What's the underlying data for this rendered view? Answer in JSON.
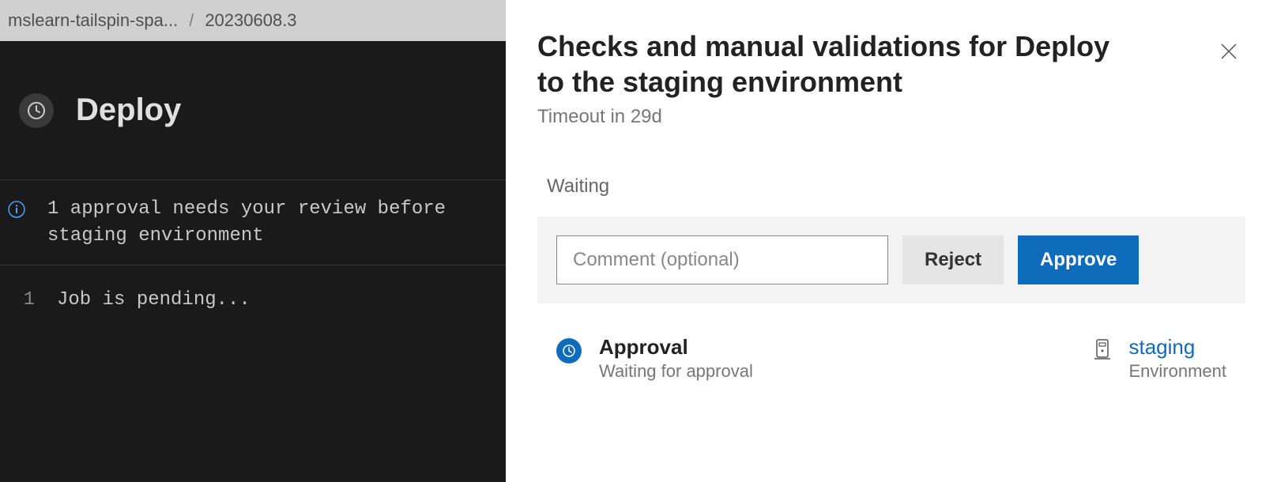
{
  "breadcrumb": {
    "pipeline": "mslearn-tailspin-spa...",
    "separator": "/",
    "run": "20230608.3"
  },
  "stage": {
    "title": "Deploy"
  },
  "banner": {
    "message": "1 approval needs your review before\nstaging environment"
  },
  "log": {
    "line_number": "1",
    "text": "Job is pending..."
  },
  "panel": {
    "title": "Checks and manual validations for Deploy to the staging environment",
    "subtitle": "Timeout in 29d",
    "waiting_label": "Waiting",
    "comment_placeholder": "Comment (optional)",
    "reject_label": "Reject",
    "approve_label": "Approve"
  },
  "check": {
    "title": "Approval",
    "subtitle": "Waiting for approval"
  },
  "environment": {
    "name": "staging",
    "label": "Environment"
  }
}
